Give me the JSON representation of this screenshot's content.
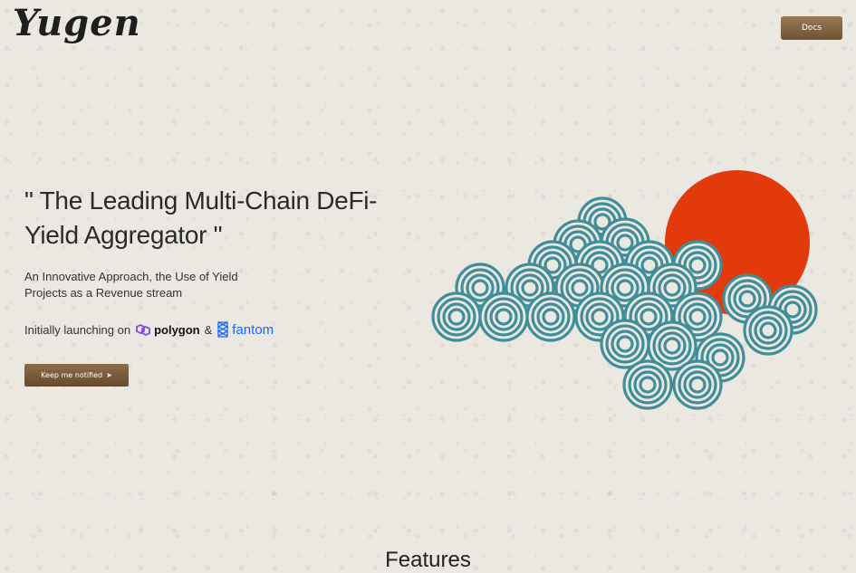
{
  "header": {
    "logo": "Yugen",
    "docs_label": "Docs"
  },
  "hero": {
    "headline": "\" The Leading Multi-Chain DeFi-Yield Aggregator \"",
    "subtitle": "An Innovative Approach, the Use of Yield Projects as a Revenue stream",
    "launch_prefix": "Initially launching on",
    "chain_1": "polygon",
    "ampersand": "&",
    "chain_2": "fantom",
    "notify_label": "Keep me notified",
    "notify_icon": "send-icon"
  },
  "illustration": {
    "sun_color": "#e23a0b",
    "wave_color": "#3f8e9a",
    "icon": "sun-and-waves"
  },
  "features": {
    "title": "Features"
  },
  "colors": {
    "button": "#7c5e3c",
    "background": "#ebe7e1",
    "polygon": "#8247e5",
    "fantom": "#1969ff"
  }
}
